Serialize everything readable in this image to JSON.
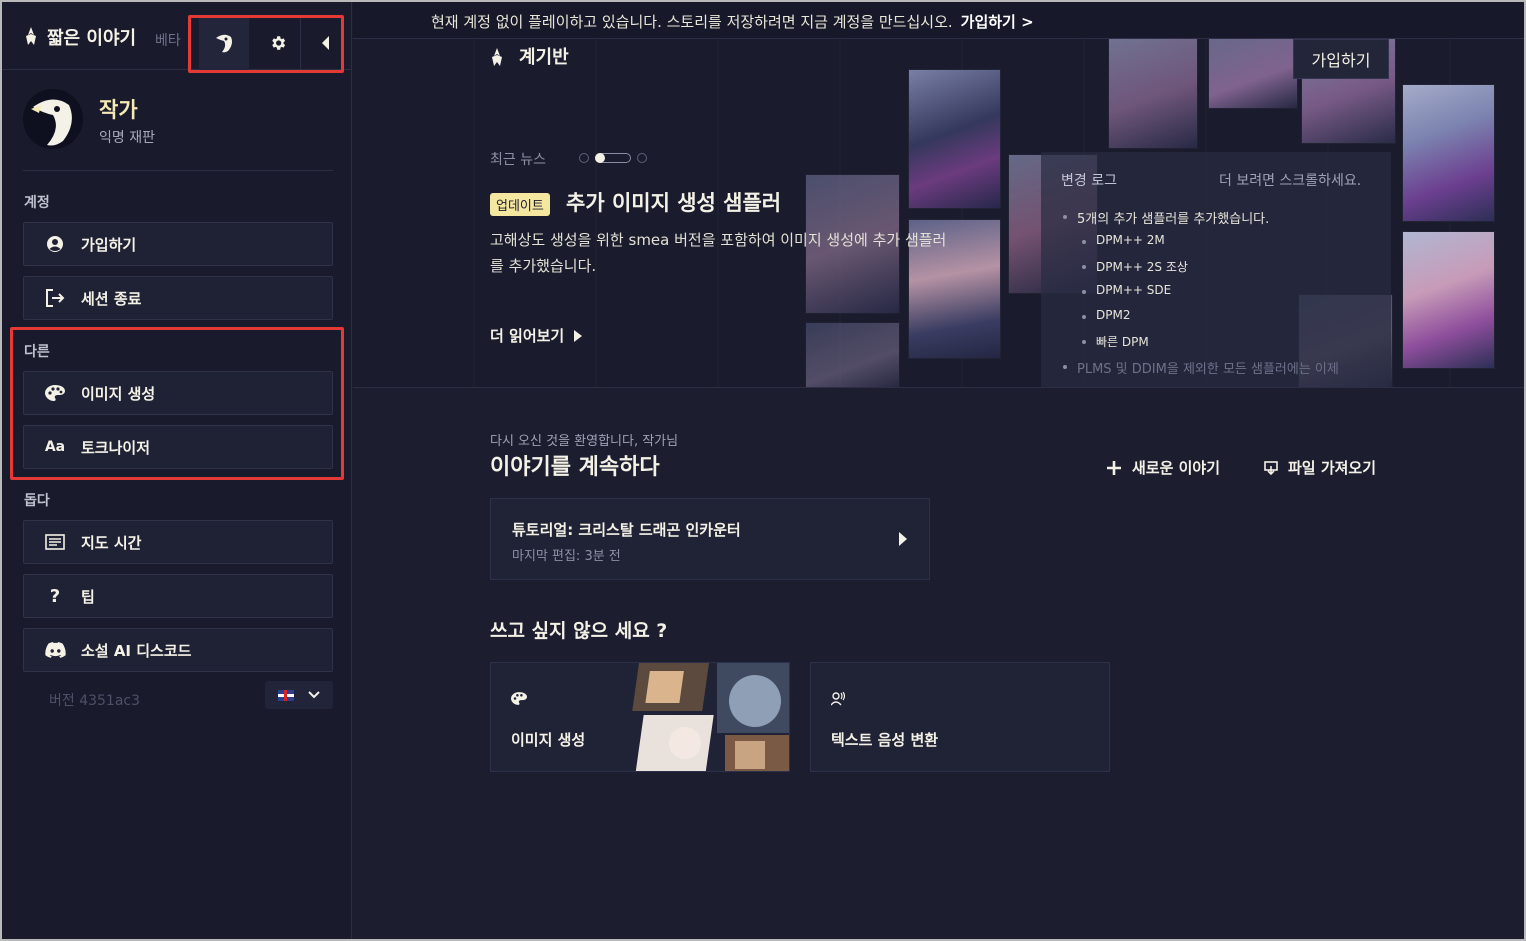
{
  "app": {
    "title": "짧은 이야기",
    "beta": "베타"
  },
  "profile": {
    "name": "작가",
    "subtitle": "익명 재판"
  },
  "sidebar": {
    "sections": {
      "account": "계정",
      "other": "다른",
      "help": "돕다"
    },
    "items": {
      "signup": "가입하기",
      "end_session": "세션 종료",
      "image_gen": "이미지 생성",
      "tokenizer": "토크나이저",
      "tokenizer_icon_text": "Aa",
      "tutorial": "지도 시간",
      "tips": "팁",
      "tips_icon_text": "?",
      "discord": "소설 AI 디스코드"
    },
    "version": "버전 4351ac3"
  },
  "notice": {
    "text": "현재 계정 없이 플레이하고 있습니다. 스토리를 저장하려면 지금 계정을 만드십시오.",
    "link": "가입하기 >"
  },
  "hero": {
    "dashboard_title": "계기반",
    "signup_button": "가입하기",
    "news_label": "최근 뉴스",
    "badge": "업데이트",
    "news_title": "추가 이미지 생성 샘플러",
    "news_body": "고해상도 생성을 위한 smea 버전을 포함하여 이미지 생성에 추가 샘플러를 추가했습니다.",
    "read_more": "더 읽어보기"
  },
  "changelog": {
    "title": "변경 로그",
    "hint": "더 보려면 스크롤하세요.",
    "items": [
      "5개의 추가 샘플러를 추가했습니다.",
      "DPM++ 2M",
      "DPM++ 2S 조상",
      "DPM++ SDE",
      "DPM2",
      "빠른 DPM",
      "PLMS 및 DDIM을 제외한 모든 샘플러에는 이제"
    ]
  },
  "welcome": {
    "subtitle": "다시 오신 것을 환영합니다, 작가님",
    "title": "이야기를 계속하다",
    "new_story": "새로운 이야기",
    "import_file": "파일 가져오기"
  },
  "story": {
    "title": "튜토리얼: 크리스탈 드래곤 인카운터",
    "meta": "마지막 편집: 3분 전"
  },
  "tools": {
    "title": "쓰고 싶지 않으 세요 ?",
    "image_gen": "이미지 생성",
    "tts": "텍스트 음성 변환"
  },
  "colors": {
    "background": "#1c1e30",
    "sidebar": "#191b2c",
    "accent": "#f5e9b4",
    "highlight": "#e53935"
  },
  "icons": [
    "logo-icon",
    "avatar-icon",
    "gear-icon",
    "chevron-left-icon",
    "user-circle-icon",
    "logout-icon",
    "palette-icon",
    "text-aa-icon",
    "document-icon",
    "question-icon",
    "discord-icon",
    "flag-icon",
    "chevron-down-icon",
    "plus-icon",
    "import-icon",
    "triangle-right-icon",
    "tts-icon"
  ]
}
